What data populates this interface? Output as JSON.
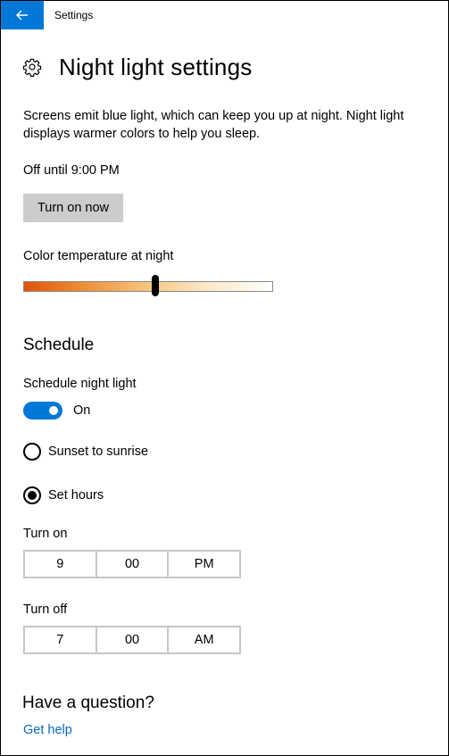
{
  "window": {
    "app_title": "Settings"
  },
  "header": {
    "title": "Night light settings"
  },
  "description": "Screens emit blue light, which can keep you up at night. Night light displays warmer colors to help you sleep.",
  "status": "Off until 9:00 PM",
  "turn_on_button": "Turn on now",
  "color_temperature": {
    "label": "Color temperature at night",
    "level": 0.53
  },
  "schedule": {
    "title": "Schedule",
    "toggle_label": "Schedule night light",
    "toggle_state": "On",
    "options": [
      {
        "label": "Sunset to sunrise",
        "selected": false
      },
      {
        "label": "Set hours",
        "selected": true
      }
    ],
    "turn_on": {
      "label": "Turn on",
      "hour": "9",
      "minute": "00",
      "period": "PM"
    },
    "turn_off": {
      "label": "Turn off",
      "hour": "7",
      "minute": "00",
      "period": "AM"
    }
  },
  "help": {
    "title": "Have a question?",
    "link": "Get help"
  },
  "colors": {
    "accent": "#0078d7",
    "button_bg": "#cccccc",
    "link": "#0a6bbd"
  }
}
